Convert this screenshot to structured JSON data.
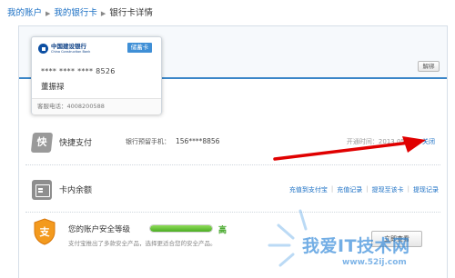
{
  "breadcrumb": {
    "items": [
      "我的账户",
      "我的银行卡",
      "银行卡详情"
    ],
    "separator": "▶"
  },
  "card": {
    "bank_name_cn": "中国建设银行",
    "bank_name_en": "China Construction Bank",
    "card_type": "储蓄卡",
    "card_number": "**** **** **** 8526",
    "holder": "董振禄",
    "service_phone": "客服电话：4008200588"
  },
  "actions": {
    "unbind_label": "解绑"
  },
  "express_pay": {
    "title": "快捷支付",
    "icon_char": "快",
    "phone_label": "银行预留手机：",
    "phone_value": "156****8856",
    "open_time": "开通时间：2013.05.03",
    "close_label": "关闭"
  },
  "balance": {
    "title": "卡内余额",
    "links": [
      "充值到支付宝",
      "充值记录",
      "提现至该卡",
      "提现记录"
    ]
  },
  "security": {
    "icon_char": "支",
    "label": "您的账户安全等级",
    "level": "高",
    "level_percent": 100,
    "description": "支付宝推出了多款安全产品，选择更适合您的安全产品。",
    "view_button": "立即查看"
  },
  "watermark": {
    "text": "我爱IT技术网",
    "url": "www.52ij.com"
  },
  "colors": {
    "link": "#1a6fc4",
    "accent_blue": "#3a86c8",
    "arrow_red": "#e00000",
    "level_green": "#3aa21d"
  }
}
